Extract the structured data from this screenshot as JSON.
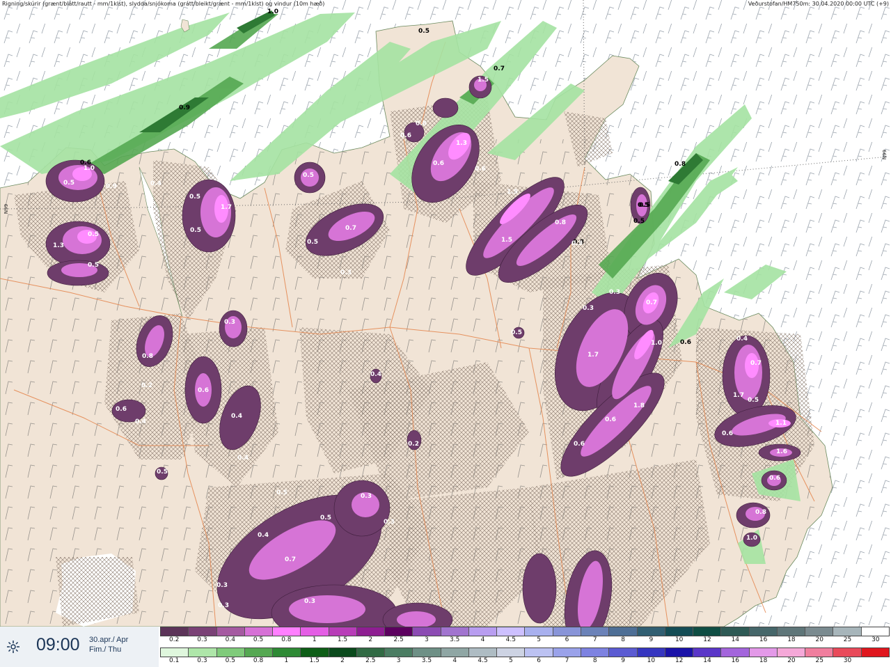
{
  "header": {
    "left_text": "Rigning/skúrir (grænt/blátt/rautt - mm/1klst), slydda/snjókoma (grátt/bleikt/grænt - mm/1klst) og vindur (10m hæð)",
    "right_text": "Veðurstofan/HM750m: 30.04.2020 00:00 UTC (+9)"
  },
  "coords": {
    "left": "N99",
    "right": "N99"
  },
  "map": {
    "land_color": "#f1e4d6",
    "sea_color": "#ffffff",
    "road_color": "#e4834a",
    "labels": [
      {
        "t": "1.0",
        "c": "#000"
      },
      {
        "t": "0.5",
        "c": "#000"
      },
      {
        "t": "0.7",
        "c": "#000"
      },
      {
        "t": "0.9",
        "c": "#000"
      },
      {
        "t": "0.8",
        "c": "#000"
      },
      {
        "t": "0.6",
        "c": "#000"
      },
      {
        "t": "0.5",
        "c": "#000"
      },
      {
        "t": "0.5",
        "c": "#000"
      },
      {
        "t": "0.8",
        "c": "#000"
      },
      {
        "t": "1.5",
        "c": "#fff"
      },
      {
        "t": "1.3",
        "c": "#fff"
      },
      {
        "t": "0.6",
        "c": "#fff"
      },
      {
        "t": "0.8",
        "c": "#fff"
      },
      {
        "t": "0.6",
        "c": "#fff"
      },
      {
        "t": "0.6",
        "c": "#fff"
      },
      {
        "t": "1.5",
        "c": "#fff"
      },
      {
        "t": "0.8",
        "c": "#fff"
      },
      {
        "t": "1.5",
        "c": "#fff"
      },
      {
        "t": "0.3",
        "c": "#fff"
      },
      {
        "t": "0.5",
        "c": "#fff"
      },
      {
        "t": "0.7",
        "c": "#fff"
      },
      {
        "t": "0.5",
        "c": "#fff"
      },
      {
        "t": "0.3",
        "c": "#fff"
      },
      {
        "t": "0.5",
        "c": "#fff"
      },
      {
        "t": "1.7",
        "c": "#fff"
      },
      {
        "t": "0.5",
        "c": "#fff"
      },
      {
        "t": "0.5",
        "c": "#fff"
      },
      {
        "t": "1.0",
        "c": "#fff"
      },
      {
        "t": "0.4",
        "c": "#fff"
      },
      {
        "t": "0.5",
        "c": "#fff"
      },
      {
        "t": "1.3",
        "c": "#fff"
      },
      {
        "t": "0.5",
        "c": "#fff"
      },
      {
        "t": "0.9",
        "c": "#fff"
      },
      {
        "t": "0.3",
        "c": "#fff"
      },
      {
        "t": "0.6",
        "c": "#fff"
      },
      {
        "t": "0.8",
        "c": "#fff"
      },
      {
        "t": "0.6",
        "c": "#fff"
      },
      {
        "t": "0.4",
        "c": "#fff"
      },
      {
        "t": "0.4",
        "c": "#fff"
      },
      {
        "t": "0.4",
        "c": "#fff"
      },
      {
        "t": "0.2",
        "c": "#fff"
      },
      {
        "t": "0.3",
        "c": "#fff"
      },
      {
        "t": "0.7",
        "c": "#fff"
      },
      {
        "t": "1.7",
        "c": "#fff"
      },
      {
        "t": "1.0",
        "c": "#fff"
      },
      {
        "t": "1.8",
        "c": "#fff"
      },
      {
        "t": "0.6",
        "c": "#fff"
      },
      {
        "t": "0.6",
        "c": "#fff"
      },
      {
        "t": "0.4",
        "c": "#fff"
      },
      {
        "t": "0.7",
        "c": "#fff"
      },
      {
        "t": "1.7",
        "c": "#fff"
      },
      {
        "t": "0.5",
        "c": "#fff"
      },
      {
        "t": "0.6",
        "c": "#fff"
      },
      {
        "t": "1.1",
        "c": "#fff"
      },
      {
        "t": "1.6",
        "c": "#fff"
      },
      {
        "t": "0.6",
        "c": "#fff"
      },
      {
        "t": "0.8",
        "c": "#fff"
      },
      {
        "t": "1.0",
        "c": "#fff"
      },
      {
        "t": "0.3",
        "c": "#fff"
      },
      {
        "t": "0.6",
        "c": "#000"
      },
      {
        "t": "0.5",
        "c": "#000"
      },
      {
        "t": "0.5",
        "c": "#fff"
      },
      {
        "t": "0.4",
        "c": "#fff"
      },
      {
        "t": "0.2",
        "c": "#fff"
      },
      {
        "t": "0.5",
        "c": "#fff"
      },
      {
        "t": "0.3",
        "c": "#fff"
      },
      {
        "t": "0.3",
        "c": "#fff"
      },
      {
        "t": "0.5",
        "c": "#fff"
      },
      {
        "t": "0.5",
        "c": "#fff"
      },
      {
        "t": "0.4",
        "c": "#fff"
      },
      {
        "t": "0.7",
        "c": "#fff"
      },
      {
        "t": "0.3",
        "c": "#fff"
      },
      {
        "t": "0.3",
        "c": "#fff"
      },
      {
        "t": "0.3",
        "c": "#fff"
      }
    ]
  },
  "footer": {
    "time": "09:00",
    "date_line1": "30.apr./ Apr",
    "date_line2": "Fim./ Thu",
    "icon": "sun-moon-icon"
  },
  "scale_top": {
    "labels": [
      "0.2",
      "0.3",
      "0.4",
      "0.5",
      "0.8",
      "1",
      "1.5",
      "2",
      "2.5",
      "3",
      "3.5",
      "4",
      "4.5",
      "5",
      "6",
      "7",
      "8",
      "9",
      "10",
      "12",
      "14",
      "16",
      "18",
      "20",
      "25",
      "30"
    ],
    "colors": [
      "#5c3459",
      "#7a4176",
      "#a55aa1",
      "#d671d6",
      "#ff7fff",
      "#e45ee5",
      "#b83db8",
      "#8e1e92",
      "#5c005f",
      "#8c4bb3",
      "#a174cf",
      "#b89df0",
      "#cdc0ff",
      "#a8b0ee",
      "#8894d8",
      "#6b82b8",
      "#4e6f96",
      "#315f72",
      "#144d55",
      "#0f4e44",
      "#2e5a55",
      "#46676a",
      "#5f7679",
      "#7b8b90",
      "#a7b5ba",
      "#ffffff"
    ]
  },
  "scale_bottom": {
    "labels": [
      "0.1",
      "0.3",
      "0.5",
      "0.8",
      "1",
      "1.5",
      "2",
      "2.5",
      "3",
      "3.5",
      "4",
      "4.5",
      "5",
      "6",
      "7",
      "8",
      "9",
      "10",
      "12",
      "14",
      "16",
      "18",
      "20",
      "25",
      "30"
    ],
    "colors": [
      "#dff7dd",
      "#aee6a9",
      "#7fcb7a",
      "#55a852",
      "#2e8a35",
      "#0e5e17",
      "#0a4a1c",
      "#316a44",
      "#4b7d63",
      "#6e9086",
      "#8fa6a4",
      "#aebcc3",
      "#cdd3e3",
      "#bcc2f2",
      "#9aa2ea",
      "#7d82e1",
      "#5b5bd2",
      "#3636c0",
      "#1a12a8",
      "#5a36c8",
      "#a365dc",
      "#e399e8",
      "#f5a8d8",
      "#f07e9e",
      "#e94a5a",
      "#e0161e"
    ]
  }
}
